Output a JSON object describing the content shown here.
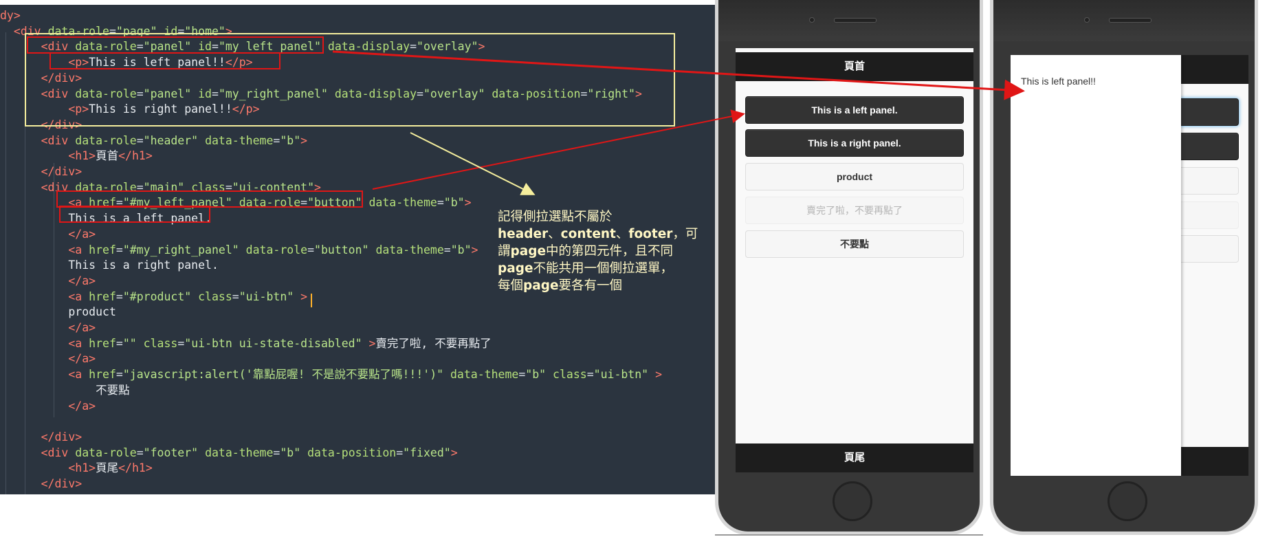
{
  "editor": {
    "lines": [
      [
        [
          "t-tag",
          "dy>"
        ]
      ],
      [
        [
          "t-text",
          "  "
        ],
        [
          "t-tag",
          "<div"
        ],
        [
          "t-text",
          " "
        ],
        [
          "t-attr",
          "data-role"
        ],
        [
          "t-eq",
          "="
        ],
        [
          "t-str",
          "\"page\""
        ],
        [
          "t-text",
          " "
        ],
        [
          "t-attr",
          "id"
        ],
        [
          "t-eq",
          "="
        ],
        [
          "t-str",
          "\"home\""
        ],
        [
          "t-tag",
          ">"
        ]
      ],
      [
        [
          "t-text",
          "      "
        ],
        [
          "t-tag",
          "<div"
        ],
        [
          "t-text",
          " "
        ],
        [
          "t-attr",
          "data-role"
        ],
        [
          "t-eq",
          "="
        ],
        [
          "t-str",
          "\"panel\""
        ],
        [
          "t-text",
          " "
        ],
        [
          "t-attr",
          "id"
        ],
        [
          "t-eq",
          "="
        ],
        [
          "t-str",
          "\"my_left_panel\""
        ],
        [
          "t-text",
          " "
        ],
        [
          "t-attr",
          "data-display"
        ],
        [
          "t-eq",
          "="
        ],
        [
          "t-str",
          "\"overlay\""
        ],
        [
          "t-tag",
          ">"
        ]
      ],
      [
        [
          "t-text",
          "          "
        ],
        [
          "t-tag",
          "<p>"
        ],
        [
          "t-text",
          "This is left panel!!"
        ],
        [
          "t-tag",
          "</p>"
        ]
      ],
      [
        [
          "t-text",
          "      "
        ],
        [
          "t-tag",
          "</div>"
        ]
      ],
      [
        [
          "t-text",
          "      "
        ],
        [
          "t-tag",
          "<div"
        ],
        [
          "t-text",
          " "
        ],
        [
          "t-attr",
          "data-role"
        ],
        [
          "t-eq",
          "="
        ],
        [
          "t-str",
          "\"panel\""
        ],
        [
          "t-text",
          " "
        ],
        [
          "t-attr",
          "id"
        ],
        [
          "t-eq",
          "="
        ],
        [
          "t-str",
          "\"my_right_panel\""
        ],
        [
          "t-text",
          " "
        ],
        [
          "t-attr",
          "data-display"
        ],
        [
          "t-eq",
          "="
        ],
        [
          "t-str",
          "\"overlay\""
        ],
        [
          "t-text",
          " "
        ],
        [
          "t-attr",
          "data-position"
        ],
        [
          "t-eq",
          "="
        ],
        [
          "t-str",
          "\"right\""
        ],
        [
          "t-tag",
          ">"
        ]
      ],
      [
        [
          "t-text",
          "          "
        ],
        [
          "t-tag",
          "<p>"
        ],
        [
          "t-text",
          "This is right panel!!"
        ],
        [
          "t-tag",
          "</p>"
        ]
      ],
      [
        [
          "t-text",
          "      "
        ],
        [
          "t-tag",
          "</div>"
        ]
      ],
      [
        [
          "t-text",
          "      "
        ],
        [
          "t-tag",
          "<div"
        ],
        [
          "t-text",
          " "
        ],
        [
          "t-attr",
          "data-role"
        ],
        [
          "t-eq",
          "="
        ],
        [
          "t-str",
          "\"header\""
        ],
        [
          "t-text",
          " "
        ],
        [
          "t-attr",
          "data-theme"
        ],
        [
          "t-eq",
          "="
        ],
        [
          "t-str",
          "\"b\""
        ],
        [
          "t-tag",
          ">"
        ]
      ],
      [
        [
          "t-text",
          "          "
        ],
        [
          "t-tag",
          "<h1>"
        ],
        [
          "t-text",
          "頁首"
        ],
        [
          "t-tag",
          "</h1>"
        ]
      ],
      [
        [
          "t-text",
          "      "
        ],
        [
          "t-tag",
          "</div>"
        ]
      ],
      [
        [
          "t-text",
          "      "
        ],
        [
          "t-tag",
          "<div"
        ],
        [
          "t-text",
          " "
        ],
        [
          "t-attr",
          "data-role"
        ],
        [
          "t-eq",
          "="
        ],
        [
          "t-str",
          "\"main\""
        ],
        [
          "t-text",
          " "
        ],
        [
          "t-attr",
          "class"
        ],
        [
          "t-eq",
          "="
        ],
        [
          "t-str",
          "\"ui-content\""
        ],
        [
          "t-tag",
          ">"
        ]
      ],
      [
        [
          "t-text",
          "          "
        ],
        [
          "t-tag",
          "<a"
        ],
        [
          "t-text",
          " "
        ],
        [
          "t-attr",
          "href"
        ],
        [
          "t-eq",
          "="
        ],
        [
          "t-str",
          "\"#my_left_panel\""
        ],
        [
          "t-text",
          " "
        ],
        [
          "t-attr",
          "data-role"
        ],
        [
          "t-eq",
          "="
        ],
        [
          "t-str",
          "\"button\""
        ],
        [
          "t-text",
          " "
        ],
        [
          "t-attr",
          "data-theme"
        ],
        [
          "t-eq",
          "="
        ],
        [
          "t-str",
          "\"b\""
        ],
        [
          "t-tag",
          ">"
        ]
      ],
      [
        [
          "t-text",
          "          This is a left panel."
        ]
      ],
      [
        [
          "t-text",
          "          "
        ],
        [
          "t-tag",
          "</a>"
        ]
      ],
      [
        [
          "t-text",
          "          "
        ],
        [
          "t-tag",
          "<a"
        ],
        [
          "t-text",
          " "
        ],
        [
          "t-attr",
          "href"
        ],
        [
          "t-eq",
          "="
        ],
        [
          "t-str",
          "\"#my_right_panel\""
        ],
        [
          "t-text",
          " "
        ],
        [
          "t-attr",
          "data-role"
        ],
        [
          "t-eq",
          "="
        ],
        [
          "t-str",
          "\"button\""
        ],
        [
          "t-text",
          " "
        ],
        [
          "t-attr",
          "data-theme"
        ],
        [
          "t-eq",
          "="
        ],
        [
          "t-str",
          "\"b\""
        ],
        [
          "t-tag",
          ">"
        ]
      ],
      [
        [
          "t-text",
          "          This is a right panel."
        ]
      ],
      [
        [
          "t-text",
          "          "
        ],
        [
          "t-tag",
          "</a>"
        ]
      ],
      [
        [
          "t-text",
          "          "
        ],
        [
          "t-tag",
          "<a"
        ],
        [
          "t-text",
          " "
        ],
        [
          "t-attr",
          "href"
        ],
        [
          "t-eq",
          "="
        ],
        [
          "t-str",
          "\"#product\""
        ],
        [
          "t-text",
          " "
        ],
        [
          "t-attr",
          "class"
        ],
        [
          "t-eq",
          "="
        ],
        [
          "t-str",
          "\"ui-btn\""
        ],
        [
          "t-text",
          " "
        ],
        [
          "t-tag",
          ">"
        ]
      ],
      [
        [
          "t-text",
          "          product"
        ]
      ],
      [
        [
          "t-text",
          "          "
        ],
        [
          "t-tag",
          "</a>"
        ]
      ],
      [
        [
          "t-text",
          "          "
        ],
        [
          "t-tag",
          "<a"
        ],
        [
          "t-text",
          " "
        ],
        [
          "t-attr",
          "href"
        ],
        [
          "t-eq",
          "="
        ],
        [
          "t-str",
          "\"\""
        ],
        [
          "t-text",
          " "
        ],
        [
          "t-attr",
          "class"
        ],
        [
          "t-eq",
          "="
        ],
        [
          "t-str",
          "\"ui-btn ui-state-disabled\""
        ],
        [
          "t-text",
          " "
        ],
        [
          "t-tag",
          ">"
        ],
        [
          "t-text",
          "賣完了啦, 不要再點了"
        ]
      ],
      [
        [
          "t-text",
          "          "
        ],
        [
          "t-tag",
          "</a>"
        ]
      ],
      [
        [
          "t-text",
          "          "
        ],
        [
          "t-tag",
          "<a"
        ],
        [
          "t-text",
          " "
        ],
        [
          "t-attr",
          "href"
        ],
        [
          "t-eq",
          "="
        ],
        [
          "t-str",
          "\"javascript:alert('靠點屁喔! 不是說不要點了嗎!!!')\""
        ],
        [
          "t-text",
          " "
        ],
        [
          "t-attr",
          "data-theme"
        ],
        [
          "t-eq",
          "="
        ],
        [
          "t-str",
          "\"b\""
        ],
        [
          "t-text",
          " "
        ],
        [
          "t-attr",
          "class"
        ],
        [
          "t-eq",
          "="
        ],
        [
          "t-str",
          "\"ui-btn\""
        ],
        [
          "t-text",
          " "
        ],
        [
          "t-tag",
          ">"
        ]
      ],
      [
        [
          "t-text",
          "              不要點"
        ]
      ],
      [
        [
          "t-text",
          "          "
        ],
        [
          "t-tag",
          "</a>"
        ]
      ],
      [
        [
          "t-text",
          ""
        ]
      ],
      [
        [
          "t-text",
          "      "
        ],
        [
          "t-tag",
          "</div>"
        ]
      ],
      [
        [
          "t-text",
          "      "
        ],
        [
          "t-tag",
          "<div"
        ],
        [
          "t-text",
          " "
        ],
        [
          "t-attr",
          "data-role"
        ],
        [
          "t-eq",
          "="
        ],
        [
          "t-str",
          "\"footer\""
        ],
        [
          "t-text",
          " "
        ],
        [
          "t-attr",
          "data-theme"
        ],
        [
          "t-eq",
          "="
        ],
        [
          "t-str",
          "\"b\""
        ],
        [
          "t-text",
          " "
        ],
        [
          "t-attr",
          "data-position"
        ],
        [
          "t-eq",
          "="
        ],
        [
          "t-str",
          "\"fixed\""
        ],
        [
          "t-tag",
          ">"
        ]
      ],
      [
        [
          "t-text",
          "          "
        ],
        [
          "t-tag",
          "<h1>"
        ],
        [
          "t-text",
          "頁尾"
        ],
        [
          "t-tag",
          "</h1>"
        ]
      ],
      [
        [
          "t-text",
          "      "
        ],
        [
          "t-tag",
          "</div>"
        ]
      ],
      [
        [
          "t-tag",
          "</div>"
        ]
      ]
    ]
  },
  "note": {
    "line1": "記得側拉選點不屬於",
    "line2_bold1": "header",
    "line2_sep1": "、",
    "line2_bold2": "content",
    "line2_sep2": "、",
    "line2_bold3": "footer",
    "line2_rest": "，可",
    "line3_pre": "謂",
    "line3_bold": "page",
    "line3_rest": "中的第四元件，且不同",
    "line4_bold": "page",
    "line4_rest": "不能共用一個側拉選單，",
    "line5_pre": "每個",
    "line5_bold": "page",
    "line5_rest": "要各有一個"
  },
  "phone1": {
    "header": "頁首",
    "footer": "頁尾",
    "buttons": [
      "This is a left panel.",
      "This is a right panel.",
      "product",
      "賣完了啦，不要再點了",
      "不要點"
    ]
  },
  "phone2": {
    "panel_text": "This is left panel!!"
  },
  "colors": {
    "editor_bg": "#2b343f",
    "tag": "#ff7a6b",
    "attr": "#b5e07a",
    "highlight_red": "#e01616",
    "highlight_yellow": "#f5ee9d",
    "bar_dark": "#1d1d1d"
  }
}
